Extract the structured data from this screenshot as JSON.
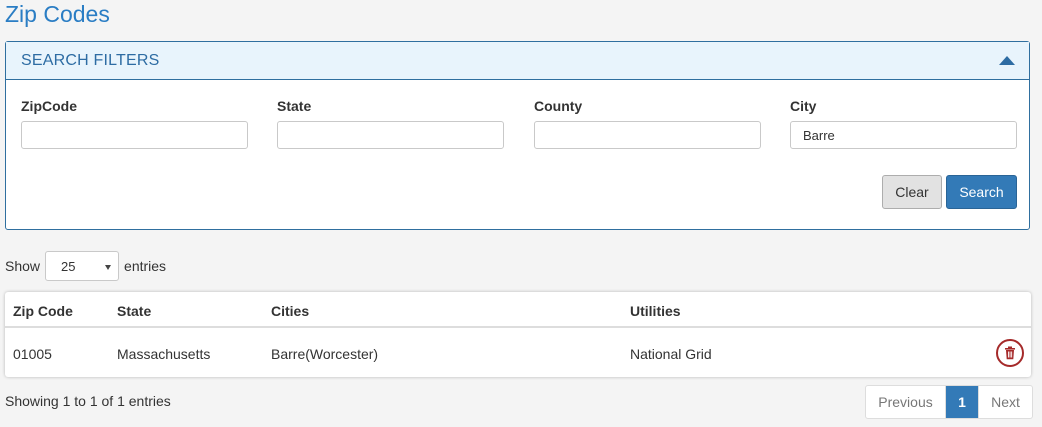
{
  "page": {
    "title": "Zip Codes"
  },
  "filters": {
    "title": "SEARCH FILTERS",
    "fields": [
      {
        "label": "ZipCode",
        "value": ""
      },
      {
        "label": "State",
        "value": ""
      },
      {
        "label": "County",
        "value": ""
      },
      {
        "label": "City",
        "value": "Barre"
      }
    ],
    "clear_label": "Clear",
    "search_label": "Search"
  },
  "length": {
    "prefix": "Show",
    "value": "25",
    "suffix": "entries"
  },
  "table": {
    "columns": [
      "Zip Code",
      "State",
      "Cities",
      "Utilities"
    ],
    "rows": [
      {
        "zip": "01005",
        "state": "Massachusetts",
        "cities": "Barre(Worcester)",
        "utilities": "National Grid"
      }
    ]
  },
  "info": "Showing 1 to 1 of 1 entries",
  "pagination": {
    "previous": "Previous",
    "current": "1",
    "next": "Next"
  },
  "colors": {
    "accent": "#337ab7",
    "title": "#2a7dc4",
    "danger": "#a52a2a"
  }
}
